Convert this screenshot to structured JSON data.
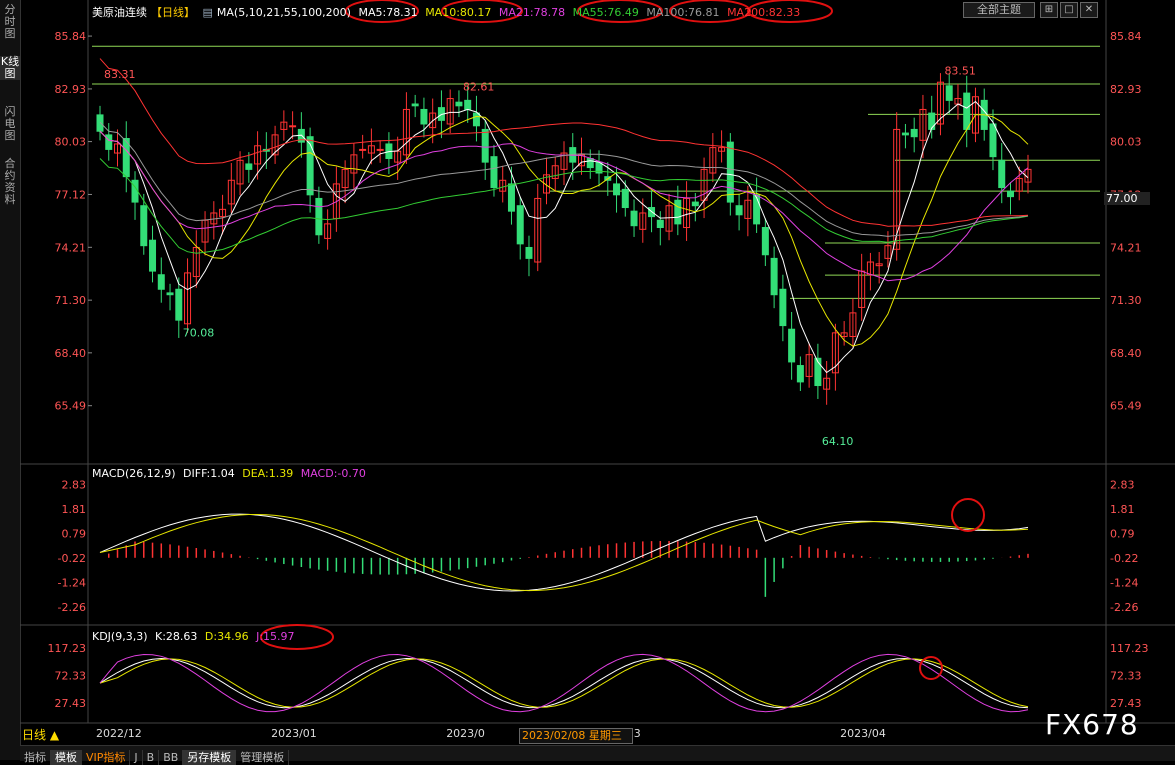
{
  "sidebar": {
    "tabs": [
      {
        "label": "分时图",
        "active": false
      },
      {
        "label": "K线图",
        "active": true
      },
      {
        "label": "闪电图",
        "active": false
      },
      {
        "label": "合约资料",
        "active": false
      }
    ]
  },
  "main_legend": {
    "instrument": "美原油连续",
    "period": "【日线】",
    "ma_spec": "MA(5,10,21,55,100,200)",
    "ma_values": [
      {
        "label": "MA5:78.31",
        "color": "#ffffff"
      },
      {
        "label": "MA10:80.17",
        "color": "#e6e600"
      },
      {
        "label": "MA21:78.78",
        "color": "#e040e0"
      },
      {
        "label": "MA55:76.49",
        "color": "#33cc33"
      },
      {
        "label": "MA100:76.81",
        "color": "#999999"
      },
      {
        "label": "MA200:82.33",
        "color": "#ff3333"
      }
    ],
    "theme_button": "全部主题",
    "window_buttons": [
      "⊞",
      "□",
      "✕"
    ]
  },
  "macd_legend": {
    "spec": "MACD(26,12,9)",
    "diff": "DIFF:1.04",
    "dea": "DEA:1.39",
    "macd": "MACD:-0.70"
  },
  "kdj_legend": {
    "spec": "KDJ(9,3,3)",
    "k": "K:28.63",
    "d": "D:34.96",
    "j": "J:15.97"
  },
  "price_axis": {
    "ticks": [
      "85.84",
      "82.93",
      "80.03",
      "77.12",
      "74.21",
      "71.30",
      "68.40",
      "65.49"
    ],
    "current_price": "77.00"
  },
  "macd_axis": {
    "ticks": [
      "2.83",
      "1.81",
      "0.79",
      "-0.22",
      "-1.24",
      "-2.26"
    ]
  },
  "kdj_axis": {
    "ticks": [
      "117.23",
      "72.33",
      "27.43"
    ]
  },
  "time_axis": {
    "labels": [
      "2022/12",
      "2023/01",
      "2023/0",
      "2023/03",
      "2023/04"
    ],
    "hover_date": "2023/02/08 星期三"
  },
  "annotations": {
    "high_left": "83.31",
    "low_left": "70.08",
    "high_mid": "82.61",
    "low_mid": "64.10",
    "high_right": "83.51"
  },
  "period_selector": "日线 ▲",
  "bottom_tabs": [
    {
      "label": "指标",
      "active": false,
      "vip": false
    },
    {
      "label": "模板",
      "active": true,
      "vip": false
    },
    {
      "label": "VIP指标",
      "active": false,
      "vip": true
    },
    {
      "label": "J",
      "active": false,
      "vip": false
    },
    {
      "label": "B",
      "active": false,
      "vip": false
    },
    {
      "label": "BB",
      "active": false,
      "vip": false
    },
    {
      "label": "另存模板",
      "active": true,
      "vip": false
    },
    {
      "label": "管理模板",
      "active": false,
      "vip": false
    }
  ],
  "watermark": "FX678",
  "colors": {
    "up": "#ff3333",
    "down": "#33dd77",
    "ma5": "#ffffff",
    "ma10": "#e6e600",
    "ma21": "#e040e0",
    "ma55": "#33cc33",
    "ma100": "#999999",
    "ma200": "#ff3333",
    "fib_lines": "#aaff66",
    "circle": "#e01010"
  },
  "chart_data": [
    {
      "type": "candlestick",
      "period": "daily",
      "y_axis_ticks": [
        85.84,
        82.93,
        80.03,
        77.12,
        74.21,
        71.3,
        68.4,
        65.49
      ],
      "ylim": [
        62.5,
        87.0
      ],
      "x_labels": [
        "2022/12",
        "2023/01",
        "2023/0",
        "2023/03",
        "2023/04"
      ],
      "close": [
        80.6,
        79.6,
        79.9,
        78.1,
        76.7,
        74.3,
        72.9,
        71.9,
        71.6,
        70.2,
        72.8,
        74.2,
        75.7,
        76.1,
        76.3,
        77.9,
        79.0,
        78.5,
        79.8,
        79.5,
        80.4,
        81.1,
        80.9,
        80.0,
        77.1,
        74.9,
        75.5,
        77.7,
        78.5,
        79.3,
        79.6,
        79.8,
        79.6,
        79.1,
        79.5,
        81.8,
        82.0,
        81.0,
        81.6,
        81.2,
        82.4,
        82.0,
        81.8,
        80.9,
        78.9,
        77.5,
        77.9,
        76.2,
        74.4,
        73.6,
        76.9,
        78.2,
        78.7,
        79.4,
        78.9,
        79.3,
        78.6,
        78.3,
        77.9,
        77.1,
        76.4,
        75.4,
        76.1,
        75.9,
        75.3,
        76.5,
        75.5,
        76.9,
        76.5,
        78.5,
        79.7,
        79.7,
        76.7,
        76.0,
        76.8,
        75.5,
        73.8,
        71.6,
        69.9,
        67.9,
        66.8,
        68.3,
        66.6,
        67.0,
        69.5,
        69.5,
        70.6,
        72.9,
        73.4,
        73.3,
        74.3,
        80.7,
        80.4,
        80.3,
        81.8,
        80.7,
        83.3,
        82.3,
        82.4,
        80.7,
        82.5,
        80.7,
        79.2,
        77.5,
        77.0,
        78.0,
        78.5
      ],
      "ma_lines": [
        {
          "name": "MA5",
          "value": 78.31
        },
        {
          "name": "MA10",
          "value": 80.17
        },
        {
          "name": "MA21",
          "value": 78.78
        },
        {
          "name": "MA55",
          "value": 76.49
        },
        {
          "name": "MA100",
          "value": 76.81
        },
        {
          "name": "MA200",
          "value": 82.33
        }
      ],
      "marked_extremes": [
        {
          "label": "83.31",
          "value": 83.31
        },
        {
          "label": "70.08",
          "value": 70.08
        },
        {
          "label": "82.61",
          "value": 82.61
        },
        {
          "label": "64.10",
          "value": 64.1
        },
        {
          "label": "83.51",
          "value": 83.51
        }
      ],
      "horizontal_levels": [
        85.28,
        83.2,
        81.53,
        79.0,
        77.3,
        74.45,
        72.68,
        71.4
      ]
    },
    {
      "type": "bar",
      "indicator": "MACD(26,12,9)",
      "y_axis_ticks": [
        2.83,
        1.81,
        0.79,
        -0.22,
        -1.24,
        -2.26
      ],
      "ylim": [
        -2.6,
        3.1
      ],
      "values": {
        "DIFF": 1.04,
        "DEA": 1.39,
        "MACD": -0.7
      }
    },
    {
      "type": "line",
      "indicator": "KDJ(9,3,3)",
      "y_axis_ticks": [
        117.23,
        72.33,
        27.43
      ],
      "ylim": [
        0,
        130
      ],
      "values": {
        "K": 28.63,
        "D": 34.96,
        "J": 15.97
      }
    }
  ]
}
